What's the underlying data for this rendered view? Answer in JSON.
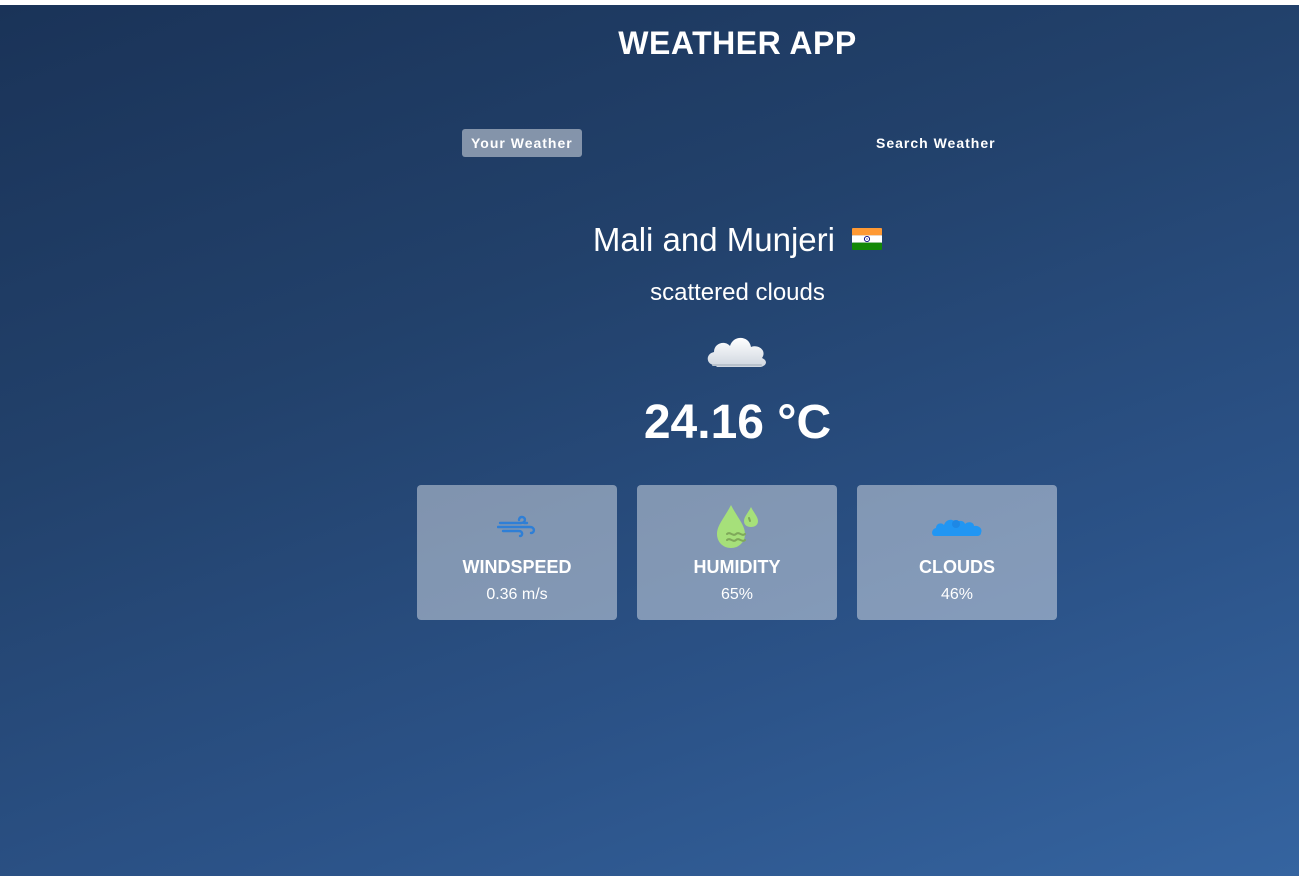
{
  "app": {
    "title": "WEATHER APP"
  },
  "tabs": [
    {
      "label": "Your Weather",
      "active": true
    },
    {
      "label": "Search Weather",
      "active": false
    }
  ],
  "weather": {
    "city": "Mali and Munjeri",
    "country_flag_icon": "india-flag-icon",
    "description": "scattered clouds",
    "condition_icon": "cloud-icon",
    "temperature": "24.16 °C"
  },
  "stats": [
    {
      "label": "WINDSPEED",
      "value": "0.36 m/s",
      "icon": "wind-icon",
      "icon_color": "#2f7fd6"
    },
    {
      "label": "HUMIDITY",
      "value": "65%",
      "icon": "humidity-icon",
      "icon_color": "#a6e07a"
    },
    {
      "label": "CLOUDS",
      "value": "46%",
      "icon": "clouds-icon",
      "icon_color": "#2196f3"
    }
  ],
  "colors": {
    "bg_top": "#1a3358",
    "bg_bottom": "#3564a0",
    "card_bg": "rgba(255,255,255,0.42)",
    "text": "#ffffff"
  }
}
